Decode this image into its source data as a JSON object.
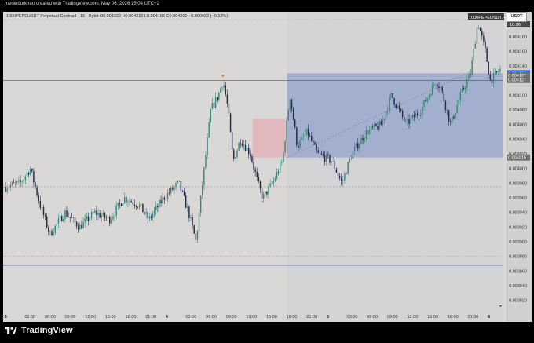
{
  "caption": "merlinburkhart created with TradingView.com, May 06, 2026 15:04 UTC+2",
  "legend": "1000PEPEUSDT Perpetual Contract · 15 · Bybit  O0.004222  H0.004222  L0.004182  C0.004200  −0.000022 (−0.52%)",
  "brand": "TradingView",
  "currency_label": "USDT",
  "symbol_badge": "1000PEPEUSDT.P",
  "symbol_badge_sub": "10:26",
  "colors": {
    "up": "#3f8a78",
    "down": "#2a2a4a",
    "target_zone": "#8ea0cc",
    "stop_zone": "#e2aeb4",
    "blue_line": "#2f3bb4",
    "red_line": "#d47a86",
    "price_badge_blue": "#2962ff",
    "price_badge_gray": "#707070"
  },
  "chart_data": {
    "type": "candlestick",
    "title": "1000PEPEUSDT Perpetual Contract · 15 · Bybit",
    "ylim": [
      0.00381,
      0.0042
    ],
    "y_ticks": [
      "0.004180",
      "0.004160",
      "0.004140",
      "0.004120",
      "0.004100",
      "0.004080",
      "0.004060",
      "0.004040",
      "0.004020",
      "0.004000",
      "0.003980",
      "0.003960",
      "0.003940",
      "0.003920",
      "0.003900",
      "0.003880",
      "0.003860",
      "0.003840",
      "0.003820"
    ],
    "x_ticks": [
      "3",
      "03:00",
      "06:00",
      "09:00",
      "12:00",
      "15:00",
      "18:00",
      "21:00",
      "4",
      "03:00",
      "06:00",
      "09:00",
      "12:00",
      "15:00",
      "18:00",
      "21:00",
      "5",
      "03:00",
      "06:00",
      "09:00",
      "12:00",
      "15:00",
      "18:00",
      "21:00",
      "6"
    ],
    "price_labels": [
      {
        "value": 0.00413,
        "text": "0.004130",
        "color": "blue"
      },
      {
        "value": 0.004127,
        "text": "0.004127",
        "color": "gray"
      },
      {
        "value": 0.004121,
        "text": "0.004127",
        "color": "gray"
      },
      {
        "value": 0.004015,
        "text": "0.004015",
        "color": "gray"
      }
    ],
    "levels": {
      "horizontal_dark": 0.00412,
      "horizontal_dashed": 0.003975,
      "horizontal_red_dotted": 0.00388,
      "horizontal_blue": 0.003868
    },
    "stop_zone": {
      "x_start": 0.4995,
      "x_end": 0.5685,
      "y_low": 0.004015,
      "y_high": 0.004068
    },
    "target_zone": {
      "x_start": 0.5685,
      "x_end": 1.0,
      "y_low": 0.004015,
      "y_high": 0.00413
    },
    "anchor_points": [
      [
        0.0,
        0.003975
      ],
      [
        0.03,
        0.00398
      ],
      [
        0.05,
        0.004
      ],
      [
        0.07,
        0.00395
      ],
      [
        0.09,
        0.00391
      ],
      [
        0.12,
        0.00394
      ],
      [
        0.15,
        0.00392
      ],
      [
        0.18,
        0.00394
      ],
      [
        0.21,
        0.00393
      ],
      [
        0.24,
        0.00396
      ],
      [
        0.27,
        0.00395
      ],
      [
        0.29,
        0.00393
      ],
      [
        0.32,
        0.00396
      ],
      [
        0.35,
        0.00398
      ],
      [
        0.37,
        0.00394
      ],
      [
        0.385,
        0.0039
      ],
      [
        0.4,
        0.00399
      ],
      [
        0.415,
        0.00408
      ],
      [
        0.43,
        0.0041
      ],
      [
        0.44,
        0.00412
      ],
      [
        0.45,
        0.00408
      ],
      [
        0.46,
        0.00401
      ],
      [
        0.475,
        0.00404
      ],
      [
        0.495,
        0.00402
      ],
      [
        0.51,
        0.00398
      ],
      [
        0.52,
        0.00396
      ],
      [
        0.54,
        0.00398
      ],
      [
        0.56,
        0.00401
      ],
      [
        0.575,
        0.0041
      ],
      [
        0.59,
        0.00403
      ],
      [
        0.61,
        0.00405
      ],
      [
        0.63,
        0.00402
      ],
      [
        0.66,
        0.00401
      ],
      [
        0.68,
        0.00398
      ],
      [
        0.7,
        0.00402
      ],
      [
        0.73,
        0.00405
      ],
      [
        0.76,
        0.00406
      ],
      [
        0.78,
        0.0041
      ],
      [
        0.81,
        0.00406
      ],
      [
        0.84,
        0.00408
      ],
      [
        0.87,
        0.00412
      ],
      [
        0.88,
        0.00411
      ],
      [
        0.9,
        0.00406
      ],
      [
        0.92,
        0.0041
      ],
      [
        0.94,
        0.00413
      ],
      [
        0.955,
        0.0042
      ],
      [
        0.97,
        0.00416
      ],
      [
        0.98,
        0.00412
      ],
      [
        1.0,
        0.004135
      ]
    ],
    "candle_count": 300,
    "seed": 7
  }
}
